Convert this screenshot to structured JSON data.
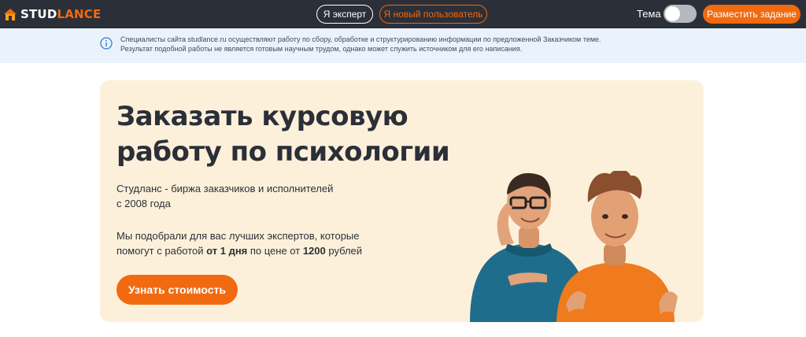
{
  "header": {
    "logo": {
      "part1": "STUD",
      "part2": "LANCE"
    },
    "expert_button": "Я эксперт",
    "new_user_button": "Я новый пользователь",
    "theme_label": "Тема",
    "theme_toggle_on": false,
    "post_task_button": "Разместить задание"
  },
  "notice": {
    "text": "Специалисты сайта studlance.ru осуществляют работу по сбору, обработке и структурированию информации по предложенной Заказчиком теме. Результат подобной работы не является готовым научным трудом, однако может служить источником для его написания."
  },
  "hero": {
    "title": "Заказать курсовую работу по психологии",
    "subtitle_line1": "Студланс - биржа заказчиков и исполнителей",
    "subtitle_line2": "с 2008 года",
    "desc_part1": "Мы подобрали для вас лучших экспертов, которые помогут с работой ",
    "desc_bold1": "от 1 дня",
    "desc_part2": " по цене от ",
    "desc_bold2": "1200",
    "desc_part3": " рублей",
    "cta_button": "Узнать стоимость"
  },
  "colors": {
    "topbar": "#2b2f38",
    "accent": "#f26a10",
    "notice_bg": "#eaf3fb",
    "hero_bg": "#fdf0da"
  },
  "icons": [
    "logo-house-icon",
    "info-icon",
    "illustration-two-men"
  ]
}
